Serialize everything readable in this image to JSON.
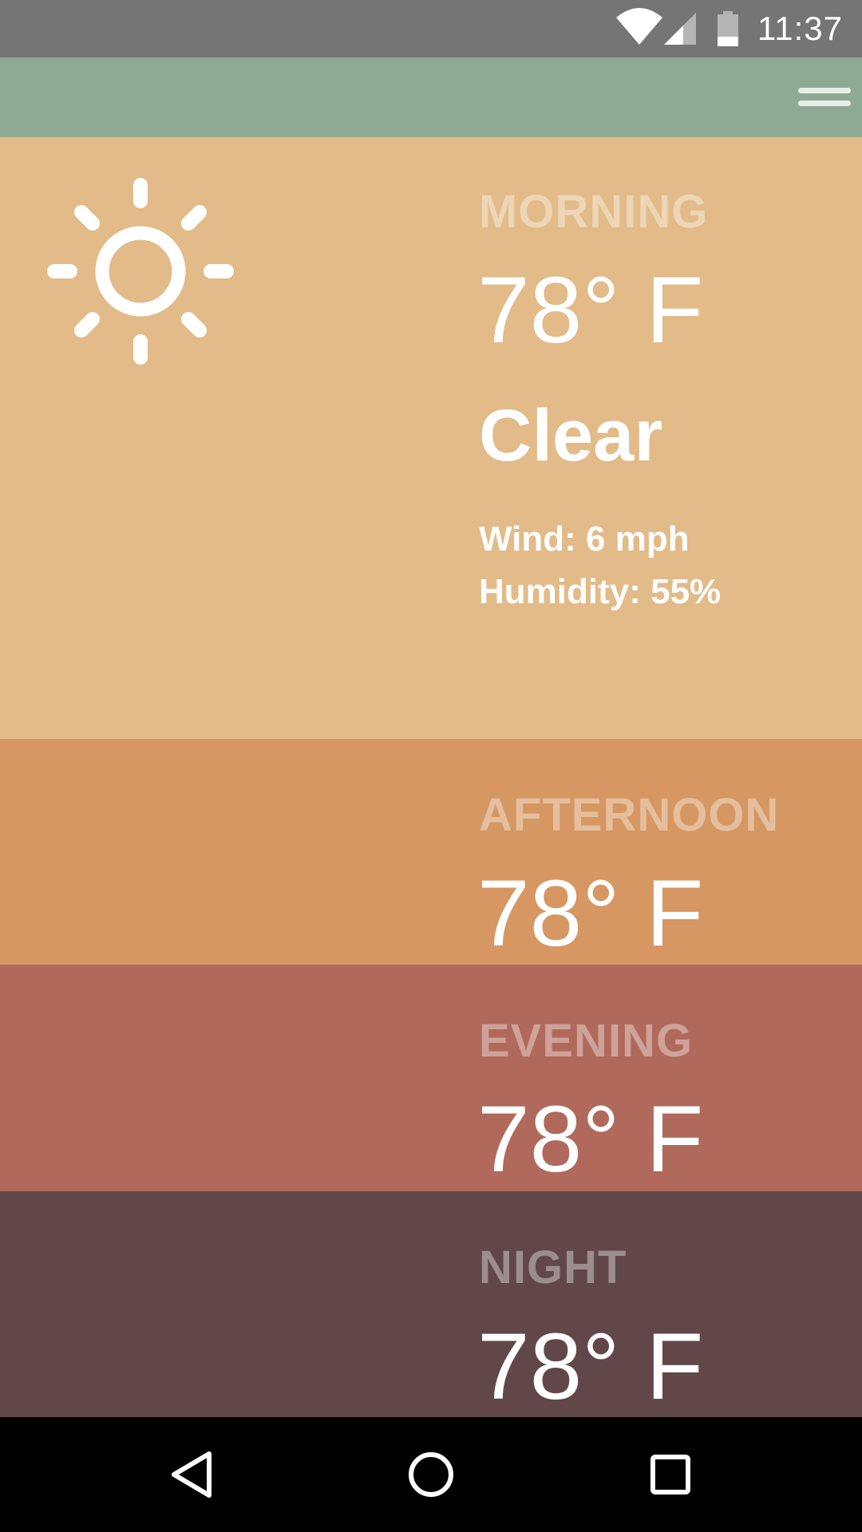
{
  "status_bar": {
    "time": "11:37",
    "icons": [
      "wifi-icon",
      "cell-signal-icon",
      "battery-icon"
    ]
  },
  "app_bar": {
    "menu_icon": "menu-icon"
  },
  "colors": {
    "status_bar": "#757575",
    "app_bar": "#8faa94",
    "morning": "#e2bb89",
    "afternoon": "#d69763",
    "evening": "#b0695b",
    "night": "#62474a",
    "nav_bar": "#000000"
  },
  "forecast": {
    "morning": {
      "label": "MORNING",
      "temp": "78° F",
      "condition": "Clear",
      "wind": "Wind: 6 mph",
      "humidity": "Humidity: 55%",
      "icon": "sun-icon"
    },
    "afternoon": {
      "label": "AFTERNOON",
      "temp": "78° F"
    },
    "evening": {
      "label": "EVENING",
      "temp": "78° F"
    },
    "night": {
      "label": "NIGHT",
      "temp": "78° F"
    }
  },
  "nav_bar": {
    "buttons": [
      "back-icon",
      "home-icon",
      "recents-icon"
    ]
  }
}
